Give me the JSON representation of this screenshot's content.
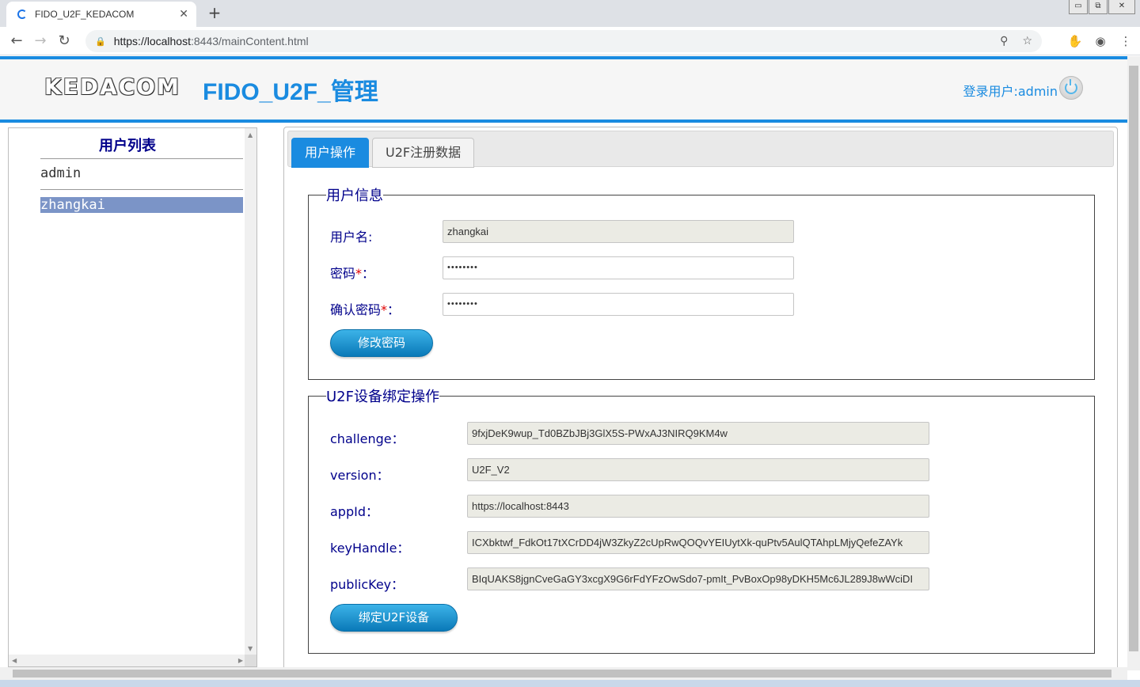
{
  "browser": {
    "tab_title": "FIDO_U2F_KEDACOM",
    "tab_close": "✕",
    "new_tab": "+",
    "url_scheme_host": "https://localhost",
    "url_rest": ":8443/mainContent.html",
    "win_min": "▭",
    "win_restore": "⧉",
    "win_close": "✕"
  },
  "header": {
    "logo": "KEDACOM",
    "title": "FIDO_U2F_管理",
    "login_user": "登录用户:admin"
  },
  "sidebar": {
    "title": "用户列表",
    "users": [
      "admin",
      "zhangkai"
    ],
    "selected": "zhangkai"
  },
  "tabs": [
    {
      "label": "用户操作",
      "active": true
    },
    {
      "label": "U2F注册数据",
      "active": false
    }
  ],
  "user_info": {
    "legend": "用户信息",
    "username_label": "用户名:",
    "username_value": "zhangkai",
    "password_label": "密码",
    "password_value": "••••••••",
    "confirm_label": "确认密码",
    "confirm_value": "••••••••",
    "required_mark": "*",
    "colon": "：",
    "change_password_button": "修改密码"
  },
  "u2f_bind": {
    "legend": "U2F设备绑定操作",
    "fields": [
      {
        "label": "challenge：",
        "value": "9fxjDeK9wup_Td0BZbJBj3GlX5S-PWxAJ3NIRQ9KM4w"
      },
      {
        "label": "version：",
        "value": "U2F_V2"
      },
      {
        "label": "appId：",
        "value": "https://localhost:8443"
      },
      {
        "label": "keyHandle：",
        "value": "ICXbktwf_FdkOt17tXCrDD4jW3ZkyZ2cUpRwQOQvYEIUytXk-quPtv5AulQTAhpLMjyQefeZAYk"
      },
      {
        "label": "publicKey：",
        "value": "BIqUAKS8jgnCveGaGY3xcgX9G6rFdYFzOwSdo7-pmIt_PvBoxOp98yDKH5Mc6JL289J8wWciDI"
      }
    ],
    "bind_button": "绑定U2F设备"
  },
  "colors": {
    "accent": "#1a8be0",
    "label": "#00008b",
    "selected_row": "#7b94c7",
    "required": "#e00000"
  }
}
